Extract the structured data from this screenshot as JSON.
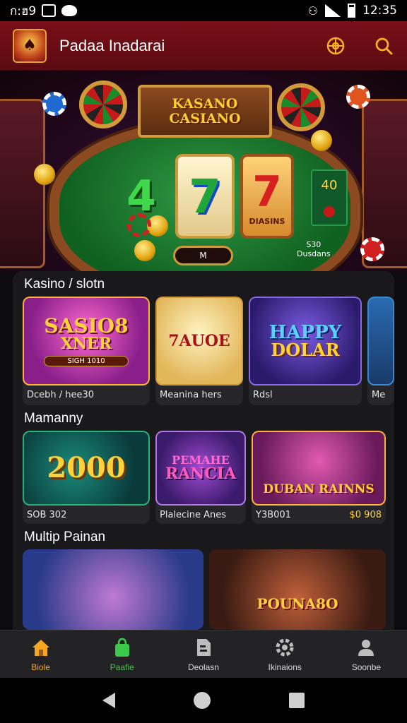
{
  "status_bar": {
    "left_text": "ก:ฮ9",
    "time": "12:35"
  },
  "header": {
    "title": "Padaa Inadarai"
  },
  "hero": {
    "sign_line1": "KASANO",
    "sign_line2": "CASIANO",
    "reel1": "4",
    "reel2": "7",
    "reel3": "7",
    "reel3_small": "DIASINS",
    "side_card_top": "40",
    "button_label": "M",
    "meta_line1": "S30",
    "meta_line2": "Dusdans"
  },
  "sections": [
    {
      "title": "Kasino / slotn",
      "tiles": [
        {
          "art_line1": "SASIO8",
          "art_line2": "XNER",
          "art_sub": "SIGH 1010",
          "caption": "Dcebh / hee30",
          "bg": "#8a1f8a"
        },
        {
          "art_line1": "7AUOE",
          "caption": "Meanina hers",
          "bg": "#f0d67a"
        },
        {
          "art_line1": "HAPPY",
          "art_line2": "DOLAR",
          "caption": "Rdsl",
          "bg": "#3a2a9a"
        },
        {
          "caption": "Me",
          "bg": "#1a4a8a"
        }
      ]
    },
    {
      "title": "Mamanny",
      "tiles": [
        {
          "art_line1": "2000",
          "caption": "SOB 302",
          "bg": "#0f5a4a"
        },
        {
          "art_line1": "PEMAHE",
          "art_line2": "RANCIA",
          "caption": "Plalecine Anes",
          "bg": "#5a2a8a"
        },
        {
          "art_line1": "DUBAN RAINNS",
          "caption": "Y3B001",
          "caption_right": "$0 908",
          "bg": "#a0307a"
        }
      ]
    },
    {
      "title": "Multip Painan",
      "tiles": [
        {
          "bg": "#2a4a9a"
        },
        {
          "art_line1": "POUNA8O",
          "bg": "#7a3a2a"
        }
      ]
    }
  ],
  "nav": [
    {
      "label": "Biole",
      "icon": "home-icon",
      "color": "#f5a623"
    },
    {
      "label": "Paafie",
      "icon": "shopping-bag-icon",
      "color": "#3cc84a"
    },
    {
      "label": "Deolasn",
      "icon": "document-icon",
      "color": "#bdbdbd"
    },
    {
      "label": "Ikinaions",
      "icon": "settings-icon",
      "color": "#bdbdbd"
    },
    {
      "label": "Soonbe",
      "icon": "profile-icon",
      "color": "#bdbdbd"
    }
  ]
}
